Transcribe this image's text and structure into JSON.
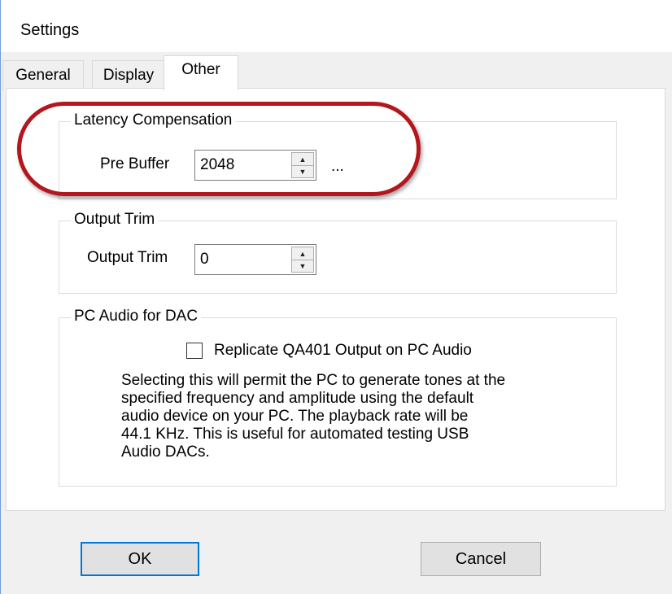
{
  "window": {
    "title": "Settings"
  },
  "tabs": [
    {
      "label": "General",
      "active": false
    },
    {
      "label": "Display",
      "active": false
    },
    {
      "label": "Other",
      "active": true
    }
  ],
  "latency": {
    "group_label": "Latency Compensation",
    "field_label": "Pre Buffer",
    "value": "2048",
    "extra_button": "..."
  },
  "output_trim": {
    "group_label": "Output Trim",
    "field_label": "Output Trim",
    "value": "0"
  },
  "pc_audio": {
    "group_label": "PC Audio for DAC",
    "checkbox_label": "Replicate QA401 Output on PC Audio",
    "checked": false,
    "description_lines": [
      "Selecting this will permit the PC to generate tones at the",
      "specified frequency and amplitude using the default",
      "audio device on your PC. The playback rate will be",
      "44.1 KHz. This is useful for automated testing USB",
      "Audio DACs."
    ]
  },
  "buttons": {
    "ok": "OK",
    "cancel": "Cancel"
  },
  "colors": {
    "highlight": "#b3161d",
    "default_button_border": "#0078d7",
    "window_border": "#6e9fd6"
  }
}
